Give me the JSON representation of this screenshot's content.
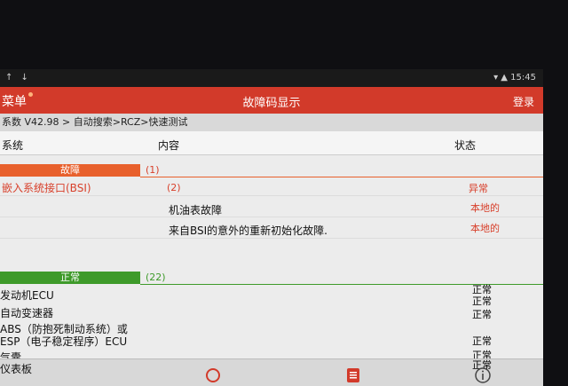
{
  "statusbar": {
    "left_icons": "↑ ↓",
    "right": "▾ ▲ 15:45"
  },
  "appbar": {
    "menu": "菜单",
    "title": "故障码显示",
    "login": "登录"
  },
  "breadcrumb": "系数 V42.98 > 自动搜索>RCZ>快速测试",
  "columns": {
    "system": "系统",
    "content": "内容",
    "status": "状态"
  },
  "faults": {
    "label": "故障",
    "count": "(1)",
    "system": "嵌入系统接口(BSI)",
    "sub_count": "(2)",
    "status": "异常",
    "items": [
      {
        "content": "机油表故障",
        "status": "本地的"
      },
      {
        "content": "来自BSI的意外的重新初始化故障.",
        "status": "本地的"
      }
    ]
  },
  "normal": {
    "label": "正常",
    "count": "(22)",
    "rows": [
      {
        "system": "发动机ECU",
        "status": "正常"
      },
      {
        "system": "自动变速器",
        "status": "正常"
      },
      {
        "system": "ABS（防抱死制动系统）或",
        "status": ""
      },
      {
        "system": "ESP（电子稳定程序）ECU",
        "status": "正常"
      },
      {
        "system": "气囊",
        "status": "正常"
      },
      {
        "system": "仪表板",
        "status": "正常"
      }
    ]
  },
  "colors": {
    "accent": "#d23a2a",
    "fault": "#e8602c",
    "normal": "#3e9a2a",
    "fault_text": "#d8402b"
  },
  "bottom_icons": [
    "search-icon",
    "report-icon",
    "info-icon"
  ]
}
